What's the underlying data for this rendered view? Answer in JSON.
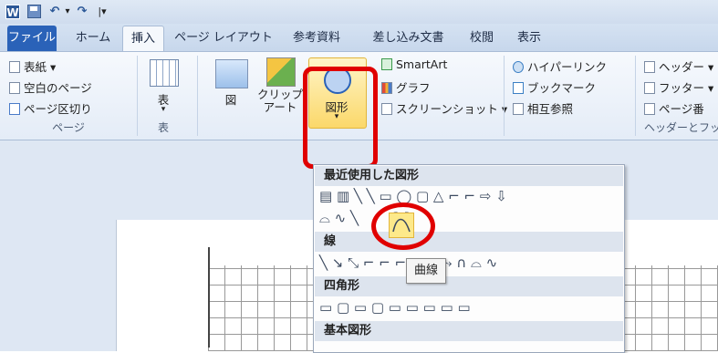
{
  "quick_access": {
    "logo": "W",
    "undo": "↶",
    "dropdown": "▾",
    "redo": "↷",
    "customize": "|▾"
  },
  "tabs": [
    "ファイル",
    "ホーム",
    "挿入",
    "ページ レイアウト",
    "参考資料",
    "差し込み文書",
    "校閲",
    "表示"
  ],
  "ribbon": {
    "pages": {
      "items": [
        "表紙 ▾",
        "空白のページ",
        "ページ区切り"
      ],
      "label": "ページ"
    },
    "table": {
      "button": "表",
      "arrow": "▾",
      "label": "表"
    },
    "illustrations": {
      "picture": "図",
      "clipart": "クリップ\nアート",
      "shapes": "図形",
      "shapes_arrow": "▾",
      "smartart": "SmartArt",
      "chart": "グラフ",
      "screenshot": "スクリーンショット ▾"
    },
    "links": {
      "hyperlink": "ハイパーリンク",
      "bookmark": "ブックマーク",
      "crossref": "相互参照"
    },
    "header_footer": {
      "header": "ヘッダー ▾",
      "footer": "フッター ▾",
      "page_number": "ページ番",
      "label": "ヘッダーとフッ"
    }
  },
  "shapes_menu": {
    "recent_header": "最近使用した図形",
    "lines_header": "線",
    "rect_header": "四角形",
    "basic_header": "基本図形",
    "tooltip": "曲線"
  },
  "colors": {
    "accent_red": "#e00000",
    "file_tab": "#2a62b8",
    "highlight": "#fde98a"
  }
}
